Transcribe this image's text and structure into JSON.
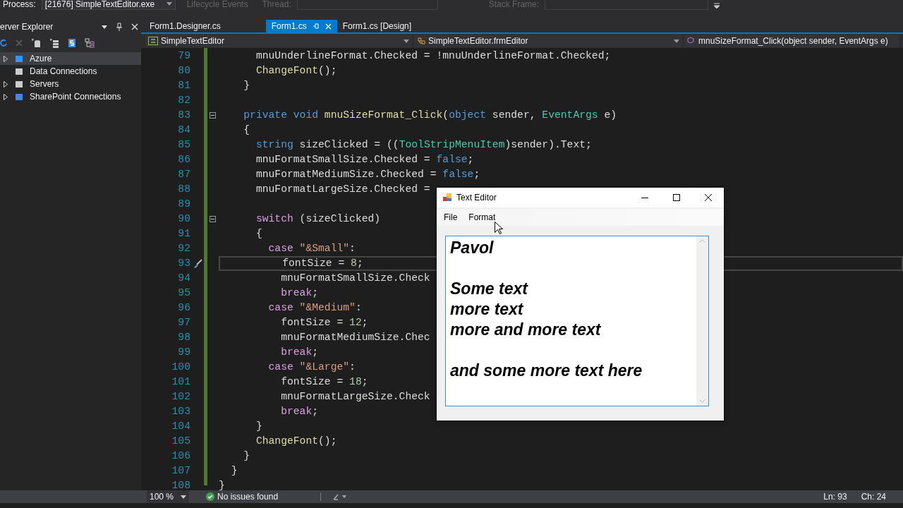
{
  "debug_toolbar": {
    "process_label": "Process:",
    "process_value": "[21676] SimpleTextEditor.exe",
    "lifecycle": "Lifecycle Events",
    "thread_label": "Thread:",
    "stack_label": "Stack Frame:"
  },
  "server_explorer": {
    "title": "erver Explorer",
    "items": [
      {
        "label": "Azure",
        "kind": "group",
        "selected": true
      },
      {
        "label": "Data Connections",
        "kind": "leaf",
        "selected": false
      },
      {
        "label": "Servers",
        "kind": "group",
        "selected": false
      },
      {
        "label": "SharePoint Connections",
        "kind": "group",
        "selected": false
      }
    ]
  },
  "tabs": [
    {
      "label": "Form1.Designer.cs",
      "selected": false
    },
    {
      "label": "Form1.cs",
      "selected": true
    },
    {
      "label": "Form1.cs [Design]",
      "selected": false
    }
  ],
  "nav_bar": {
    "project": "SimpleTextEditor",
    "class": "SimpleTextEditor.frmEditor",
    "member": "mnuSizeFormat_Click(object sender, EventArgs e)"
  },
  "code_lines": [
    {
      "number": "79",
      "current": false,
      "fold": false,
      "tokens": [
        {
          "kind": "plain",
          "text": "      mnuUnderlineFormat.Checked = !mnuUnderlineFormat.Checked;"
        }
      ]
    },
    {
      "number": "80",
      "current": false,
      "fold": false,
      "tokens": [
        {
          "kind": "method",
          "text": "      ChangeFont"
        },
        {
          "kind": "plain",
          "text": "();"
        }
      ]
    },
    {
      "number": "81",
      "current": false,
      "fold": false,
      "tokens": [
        {
          "kind": "plain",
          "text": "    }"
        }
      ]
    },
    {
      "number": "82",
      "current": false,
      "fold": false
    },
    {
      "number": "83",
      "current": false,
      "fold": true,
      "tokens": [
        {
          "kind": "keyword",
          "text": "    private void "
        },
        {
          "kind": "method",
          "text": "mnuSizeFormat_Click"
        },
        {
          "kind": "plain",
          "text": "("
        },
        {
          "kind": "keyword",
          "text": "object"
        },
        {
          "kind": "plain",
          "text": " sender, "
        },
        {
          "kind": "type",
          "text": "EventArgs"
        },
        {
          "kind": "plain",
          "text": " e)"
        }
      ]
    },
    {
      "number": "84",
      "current": false,
      "fold": false,
      "tokens": [
        {
          "kind": "plain",
          "text": "    {"
        }
      ]
    },
    {
      "number": "85",
      "current": false,
      "fold": false,
      "tokens": [
        {
          "kind": "keyword",
          "text": "      string"
        },
        {
          "kind": "plain",
          "text": " sizeClicked = (("
        },
        {
          "kind": "type",
          "text": "ToolStripMenuItem"
        },
        {
          "kind": "plain",
          "text": ")sender).Text;"
        }
      ]
    },
    {
      "number": "86",
      "current": false,
      "fold": false,
      "tokens": [
        {
          "kind": "plain",
          "text": "      mnuFormatSmallSize.Checked = "
        },
        {
          "kind": "keyword",
          "text": "false"
        },
        {
          "kind": "plain",
          "text": ";"
        }
      ]
    },
    {
      "number": "87",
      "current": false,
      "fold": false,
      "tokens": [
        {
          "kind": "plain",
          "text": "      mnuFormatMediumSize.Checked = "
        },
        {
          "kind": "keyword",
          "text": "false"
        },
        {
          "kind": "plain",
          "text": ";"
        }
      ]
    },
    {
      "number": "88",
      "current": false,
      "fold": false,
      "tokens": [
        {
          "kind": "plain",
          "text": "      mnuFormatLargeSize.Checked ="
        }
      ]
    },
    {
      "number": "89",
      "current": false,
      "fold": false
    },
    {
      "number": "90",
      "current": false,
      "fold": true,
      "tokens": [
        {
          "kind": "control",
          "text": "      switch"
        },
        {
          "kind": "plain",
          "text": " (sizeClicked)"
        }
      ]
    },
    {
      "number": "91",
      "current": false,
      "fold": false,
      "tokens": [
        {
          "kind": "plain",
          "text": "      {"
        }
      ]
    },
    {
      "number": "92",
      "current": false,
      "fold": false,
      "tokens": [
        {
          "kind": "control",
          "text": "        case "
        },
        {
          "kind": "string",
          "text": "\"&Small\""
        },
        {
          "kind": "plain",
          "text": ":"
        }
      ]
    },
    {
      "number": "93",
      "current": true,
      "fold": false,
      "tokens": [
        {
          "kind": "plain",
          "text": "          fontSize = "
        },
        {
          "kind": "number",
          "text": "8"
        },
        {
          "kind": "plain",
          "text": ";"
        }
      ]
    },
    {
      "number": "94",
      "current": false,
      "fold": false,
      "tokens": [
        {
          "kind": "plain",
          "text": "          mnuFormatSmallSize.Check"
        }
      ]
    },
    {
      "number": "95",
      "current": false,
      "fold": false,
      "tokens": [
        {
          "kind": "control",
          "text": "          break"
        },
        {
          "kind": "plain",
          "text": ";"
        }
      ]
    },
    {
      "number": "96",
      "current": false,
      "fold": false,
      "tokens": [
        {
          "kind": "control",
          "text": "        case "
        },
        {
          "kind": "string",
          "text": "\"&Medium\""
        },
        {
          "kind": "plain",
          "text": ":"
        }
      ]
    },
    {
      "number": "97",
      "current": false,
      "fold": false,
      "tokens": [
        {
          "kind": "plain",
          "text": "          fontSize = "
        },
        {
          "kind": "number",
          "text": "12"
        },
        {
          "kind": "plain",
          "text": ";"
        }
      ]
    },
    {
      "number": "98",
      "current": false,
      "fold": false,
      "tokens": [
        {
          "kind": "plain",
          "text": "          mnuFormatMediumSize.Chec"
        }
      ]
    },
    {
      "number": "99",
      "current": false,
      "fold": false,
      "tokens": [
        {
          "kind": "control",
          "text": "          break"
        },
        {
          "kind": "plain",
          "text": ";"
        }
      ]
    },
    {
      "number": "100",
      "current": false,
      "fold": false,
      "tokens": [
        {
          "kind": "control",
          "text": "        case "
        },
        {
          "kind": "string",
          "text": "\"&Large\""
        },
        {
          "kind": "plain",
          "text": ":"
        }
      ]
    },
    {
      "number": "101",
      "current": false,
      "fold": false,
      "tokens": [
        {
          "kind": "plain",
          "text": "          fontSize = "
        },
        {
          "kind": "number",
          "text": "18"
        },
        {
          "kind": "plain",
          "text": ";"
        }
      ]
    },
    {
      "number": "102",
      "current": false,
      "fold": false,
      "tokens": [
        {
          "kind": "plain",
          "text": "          mnuFormatLargeSize.Check"
        }
      ]
    },
    {
      "number": "103",
      "current": false,
      "fold": false,
      "tokens": [
        {
          "kind": "control",
          "text": "          break"
        },
        {
          "kind": "plain",
          "text": ";"
        }
      ]
    },
    {
      "number": "104",
      "current": false,
      "fold": false,
      "tokens": [
        {
          "kind": "plain",
          "text": "      }"
        }
      ]
    },
    {
      "number": "105",
      "current": false,
      "fold": false,
      "tokens": [
        {
          "kind": "method",
          "text": "      ChangeFont"
        },
        {
          "kind": "plain",
          "text": "();"
        }
      ]
    },
    {
      "number": "106",
      "current": false,
      "fold": false,
      "tokens": [
        {
          "kind": "plain",
          "text": "    }"
        }
      ]
    },
    {
      "number": "107",
      "current": false,
      "fold": false,
      "tokens": [
        {
          "kind": "plain",
          "text": "  }"
        }
      ]
    },
    {
      "number": "108",
      "current": false,
      "fold": false,
      "tokens": [
        {
          "kind": "plain",
          "text": "}"
        }
      ]
    }
  ],
  "app_window": {
    "title": "Text Editor",
    "menu": [
      "File",
      "Format"
    ],
    "text": "Pavol\n\nSome text\nmore text\nmore and more text\n\nand some more text here"
  },
  "status_bar": {
    "zoom": "100 %",
    "issues": "No issues found",
    "line": "Ln: 93",
    "column": "Ch: 24"
  }
}
